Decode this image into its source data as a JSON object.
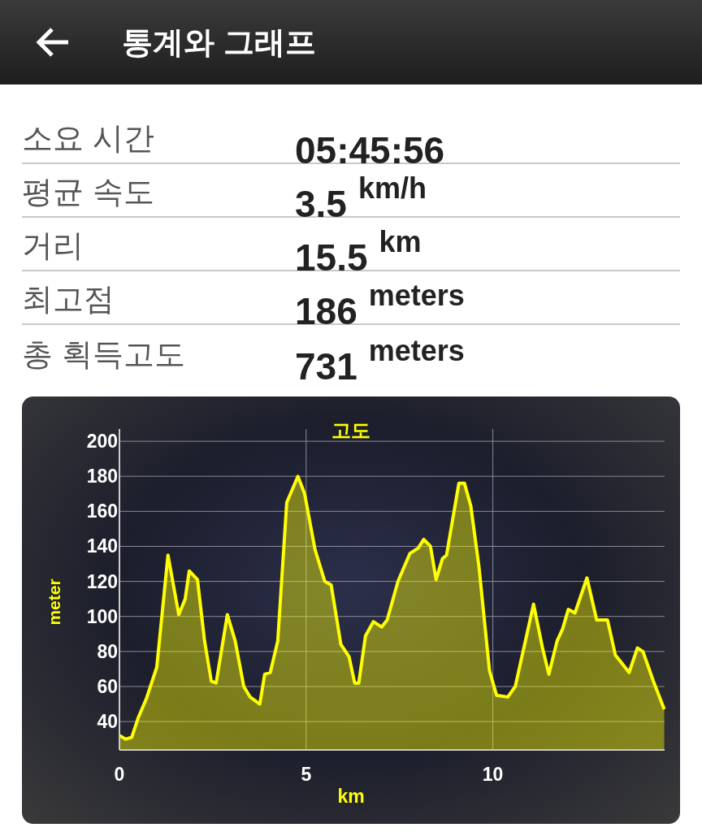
{
  "header": {
    "title": "통계와 그래프"
  },
  "stats": [
    {
      "label": "소요 시간",
      "value": "05:45:56"
    },
    {
      "label": "평균 속도",
      "value": "3.5",
      "unit": "km/h"
    },
    {
      "label": "거리",
      "value": "15.5",
      "unit": "km"
    },
    {
      "label": "최고점",
      "value": "186",
      "unit": "meters"
    },
    {
      "label": "총 획득고도",
      "value": "731",
      "unit": "meters"
    }
  ],
  "elevation": {
    "chart_data": {
      "type": "area",
      "title": "고도",
      "xlabel": "km",
      "ylabel": "meter",
      "x": [
        0,
        0.17,
        0.33,
        0.5,
        0.72,
        1.0,
        1.3,
        1.59,
        1.76,
        1.87,
        2.09,
        2.28,
        2.46,
        2.59,
        2.89,
        3.1,
        3.33,
        3.5,
        3.76,
        3.89,
        4.04,
        4.24,
        4.48,
        4.78,
        4.96,
        5.24,
        5.5,
        5.67,
        5.93,
        6.15,
        6.3,
        6.41,
        6.59,
        6.8,
        7.02,
        7.17,
        7.46,
        7.78,
        8.0,
        8.15,
        8.33,
        8.48,
        8.65,
        8.76,
        9.09,
        9.24,
        9.41,
        9.63,
        9.91,
        10.1,
        10.4,
        10.6,
        10.83,
        11.09,
        11.33,
        11.5,
        11.72,
        11.87,
        12.02,
        12.2,
        12.52,
        12.78,
        13.07,
        13.28,
        13.65,
        13.87,
        14.02,
        14.3,
        14.59
      ],
      "series": [
        {
          "color": "#ffff00",
          "values": [
            32,
            30,
            31,
            42,
            53,
            71,
            135,
            101,
            110,
            126,
            121,
            86,
            63,
            62,
            101,
            86,
            60,
            54,
            50,
            67,
            68,
            86,
            165,
            180,
            170,
            138,
            120,
            118,
            84,
            77,
            62,
            62,
            89,
            97,
            94,
            98,
            120,
            136,
            139,
            144,
            140,
            121,
            133,
            135,
            176,
            176,
            163,
            128,
            69,
            55,
            54,
            60,
            82,
            107,
            82,
            67,
            86,
            93,
            104,
            102,
            122,
            98,
            98,
            78,
            68,
            82,
            80,
            63,
            47
          ]
        }
      ],
      "grid": true,
      "xlim": [
        0,
        14.6
      ],
      "ylim": [
        23.8,
        207
      ],
      "xticks": [
        0,
        5,
        10
      ],
      "yticks": [
        40,
        60,
        80,
        100,
        120,
        140,
        160,
        180,
        200
      ]
    }
  }
}
